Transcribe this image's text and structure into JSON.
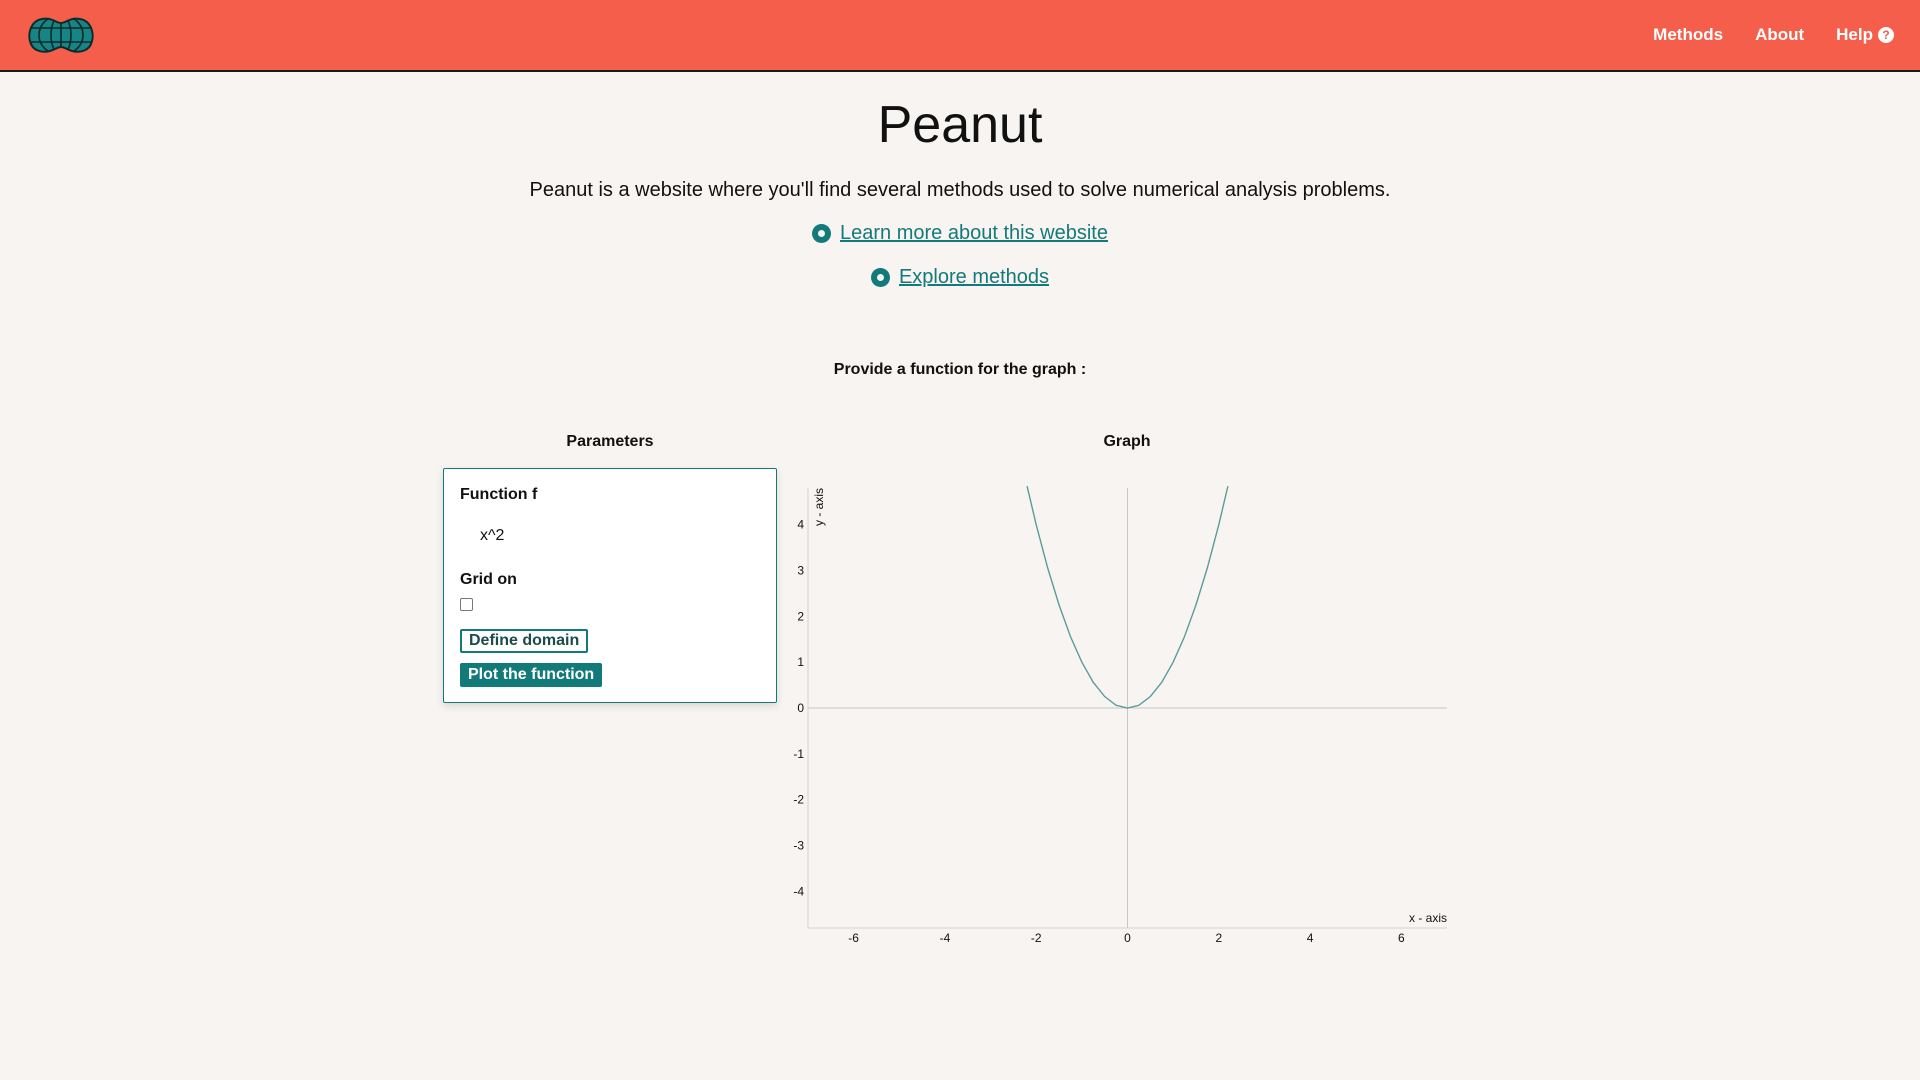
{
  "navbar": {
    "logo_name": "peanut-logo",
    "links": [
      {
        "label": "Methods"
      },
      {
        "label": "About"
      },
      {
        "label": "Help",
        "icon": "question-circle-icon"
      }
    ]
  },
  "hero": {
    "title": "Peanut",
    "intro": "Peanut is a website where you'll find several methods used to solve numerical analysis problems.",
    "links": [
      {
        "label": "Learn more about this website"
      },
      {
        "label": "Explore methods"
      }
    ]
  },
  "prompt": "Provide a function for the graph :",
  "parameters": {
    "heading": "Parameters",
    "function_label": "Function f",
    "function_value": "x^2",
    "grid_label": "Grid on",
    "grid_checked": false,
    "define_domain_label": "Define domain",
    "plot_label": "Plot the function"
  },
  "graph": {
    "heading": "Graph"
  },
  "colors": {
    "navbar": "#f55e4a",
    "accent": "#137a7a",
    "background": "#f7f4f1",
    "curve": "#5d9b9b"
  },
  "chart_data": {
    "type": "line",
    "function": "x^2",
    "xlabel": "x - axis",
    "ylabel": "y - axis",
    "xlim": [
      -7,
      7
    ],
    "ylim": [
      -4.8,
      4.8
    ],
    "xticks": [
      -6,
      -4,
      -2,
      0,
      2,
      4,
      6
    ],
    "yticks": [
      4,
      3,
      2,
      1,
      0,
      -1,
      -2,
      -3,
      -4
    ],
    "grid": false,
    "series": [
      {
        "x": [
          -2.2,
          -2,
          -1.75,
          -1.5,
          -1.25,
          -1,
          -0.75,
          -0.5,
          -0.25,
          0,
          0.25,
          0.5,
          0.75,
          1,
          1.25,
          1.5,
          1.75,
          2,
          2.2
        ],
        "y": [
          4.84,
          4,
          3.06,
          2.25,
          1.56,
          1,
          0.56,
          0.25,
          0.06,
          0,
          0.06,
          0.25,
          0.56,
          1,
          1.56,
          2.25,
          3.06,
          4,
          4.84
        ]
      }
    ]
  }
}
